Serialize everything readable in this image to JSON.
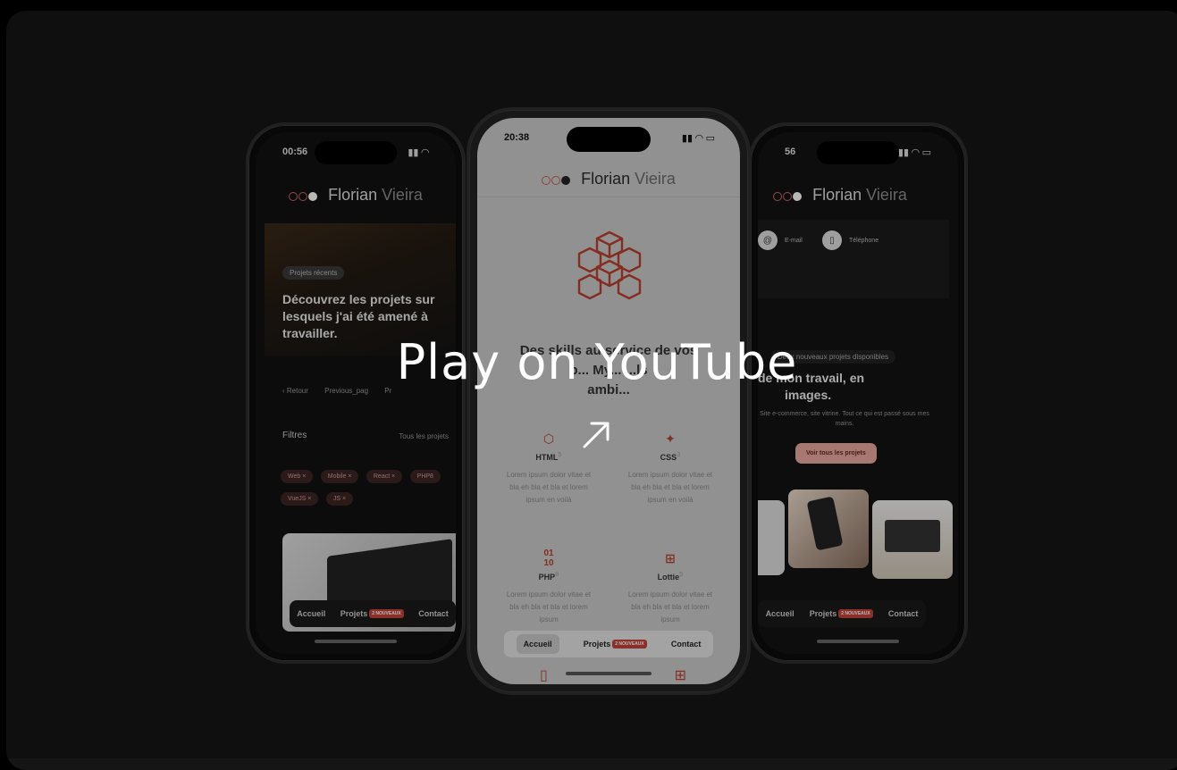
{
  "overlay": {
    "title": "Play on YouTube",
    "arrow_icon": "arrow-up-right-icon"
  },
  "left_phone": {
    "time": "00:56",
    "brand_first": "Florian",
    "brand_last": "Vieira",
    "hero_pill": "Projets récents",
    "hero_title": "Découvrez les projets sur lesquels j'ai été amené à travailler.",
    "crumb_back": "Retour",
    "crumb_prev": "Previous_pag",
    "crumb_next": "Pr",
    "filters_label": "Filtres",
    "filters_all": "Tous les projets",
    "chips": [
      "Web ×",
      "Mobile ×",
      "React ×",
      "PHP8",
      "VueJS ×",
      "JS ×"
    ],
    "tabs": {
      "home": "Accueil",
      "projects": "Projets",
      "badge": "2 NOUVEAUX",
      "contact": "Contact"
    }
  },
  "center_phone": {
    "time": "20:38",
    "brand_first": "Florian",
    "brand_last": "Vieira",
    "headline_l1": "Des skills au service de vos",
    "headline_l2": "p... My... ...ls",
    "headline_l3": "ambi...",
    "skills": [
      {
        "name": "HTML",
        "sup": "5",
        "desc": "Lorem ipsum dolor vitae et bla eh bla et bla et lorem ipsum en voilà"
      },
      {
        "name": "CSS",
        "sup": "3",
        "desc": "Lorem ipsum dolor vitae et bla eh bla et bla et lorem ipsum en voilà"
      },
      {
        "name": "PHP",
        "sup": "8",
        "desc": "Lorem ipsum dolor vitae et bla eh bla et bla et lorem ipsum"
      },
      {
        "name": "Lottie",
        "sup": "5",
        "desc": "Lorem ipsum dolor vitae et bla eh bla et bla et lorem ipsum"
      }
    ],
    "php_icon_top": "01",
    "php_icon_bottom": "10",
    "tabs": {
      "home": "Accueil",
      "projects": "Projets",
      "badge": "2 NOUVEAUX",
      "contact": "Contact"
    }
  },
  "right_phone": {
    "time": "56",
    "brand_first": "Florian",
    "brand_last": "Vieira",
    "email": "E-mail",
    "phone": "Téléphone",
    "notice": "Deux nouveaux projets disponibles",
    "title_l1": "de mon travail, en",
    "title_l2": "images.",
    "subtitle": "Site e-commerce, site vitrine. Tout ce qui est passé sous mes mains.",
    "button": "Voir tous les projets",
    "tabs": {
      "home": "Accueil",
      "projects": "Projets",
      "badge": "2 NOUVEAUX",
      "contact": "Contact"
    }
  },
  "colors": {
    "accent": "#c0433a",
    "accent_light": "#e8a79d",
    "card_bg": "#151515"
  }
}
